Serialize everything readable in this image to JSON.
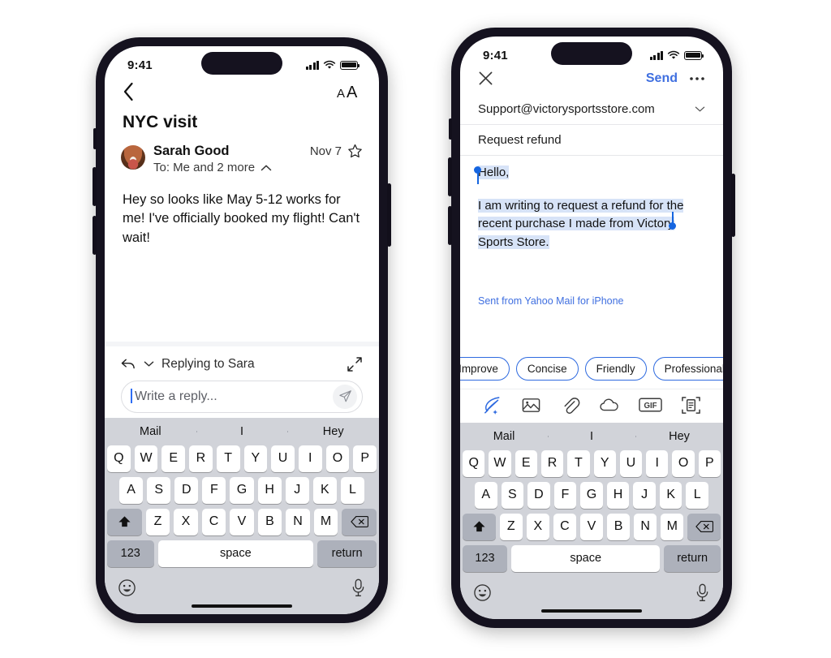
{
  "left_phone": {
    "status": {
      "time": "9:41"
    },
    "nav": {
      "back_icon": "chevron-left-icon",
      "text_size_icon": "AA"
    },
    "message": {
      "subject": "NYC visit",
      "sender": "Sarah Good",
      "date": "Nov 7",
      "recipients": "To: Me and 2 more",
      "body": "Hey so looks like May 5-12 works for me! I've officially booked my flight! Can't wait!"
    },
    "reply": {
      "label": "Replying to Sara",
      "placeholder": "Write a reply...",
      "reply_icon": "reply-arrow-icon",
      "chevron_icon": "chevron-down-icon",
      "expand_icon": "expand-arrows-icon",
      "send_icon": "send-paper-plane-icon"
    }
  },
  "right_phone": {
    "status": {
      "time": "9:41"
    },
    "nav": {
      "close_icon": "close-x-icon",
      "send_label": "Send",
      "more_icon": "more-dots-icon",
      "send_color": "#3f6fe0"
    },
    "compose": {
      "to_value": "Support@victorysportsstore.com",
      "to_chevron_icon": "chevron-down-icon",
      "subject_value": "Request refund",
      "body_line1": "Hello,",
      "body_line2": "I am writing to request a refund for the recent purchase I made from Victory Sports Store.",
      "signature": "Sent from Yahoo Mail for iPhone",
      "signature_color": "#3f6fe0",
      "selection_color": "#d7e3f7",
      "handle_color": "#1565e0"
    },
    "pills": [
      {
        "label": "Improve"
      },
      {
        "label": "Concise"
      },
      {
        "label": "Friendly"
      },
      {
        "label": "Professional"
      }
    ],
    "pill_border_color": "#2f6be0",
    "toolbar": [
      {
        "name": "ai-quill-icon"
      },
      {
        "name": "photo-icon"
      },
      {
        "name": "attachment-paperclip-icon"
      },
      {
        "name": "cloud-icon"
      },
      {
        "name": "gif-icon",
        "label": "GIF"
      },
      {
        "name": "document-scan-icon"
      }
    ]
  },
  "keyboard": {
    "suggestions": [
      "Mail",
      "I",
      "Hey"
    ],
    "row1": [
      "Q",
      "W",
      "E",
      "R",
      "T",
      "Y",
      "U",
      "I",
      "O",
      "P"
    ],
    "row2": [
      "A",
      "S",
      "D",
      "F",
      "G",
      "H",
      "J",
      "K",
      "L"
    ],
    "row3": [
      "Z",
      "X",
      "C",
      "V",
      "B",
      "N",
      "M"
    ],
    "shift_icon": "shift-arrow-icon",
    "backspace_icon": "backspace-delete-icon",
    "numbers_label": "123",
    "space_label": "space",
    "return_label": "return",
    "emoji_icon": "emoji-smiley-icon",
    "mic_icon": "microphone-icon"
  }
}
